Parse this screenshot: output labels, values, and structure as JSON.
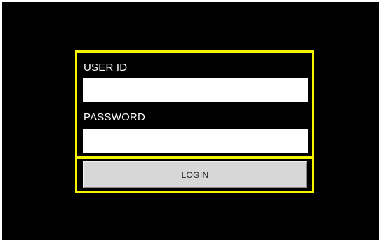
{
  "login_form": {
    "user_id_label": "USER ID",
    "user_id_value": "",
    "password_label": "PASSWORD",
    "password_value": "",
    "login_button_label": "LOGIN"
  },
  "colors": {
    "background": "#000000",
    "highlight_border": "#f5f500",
    "button_face": "#d7d7d7"
  }
}
